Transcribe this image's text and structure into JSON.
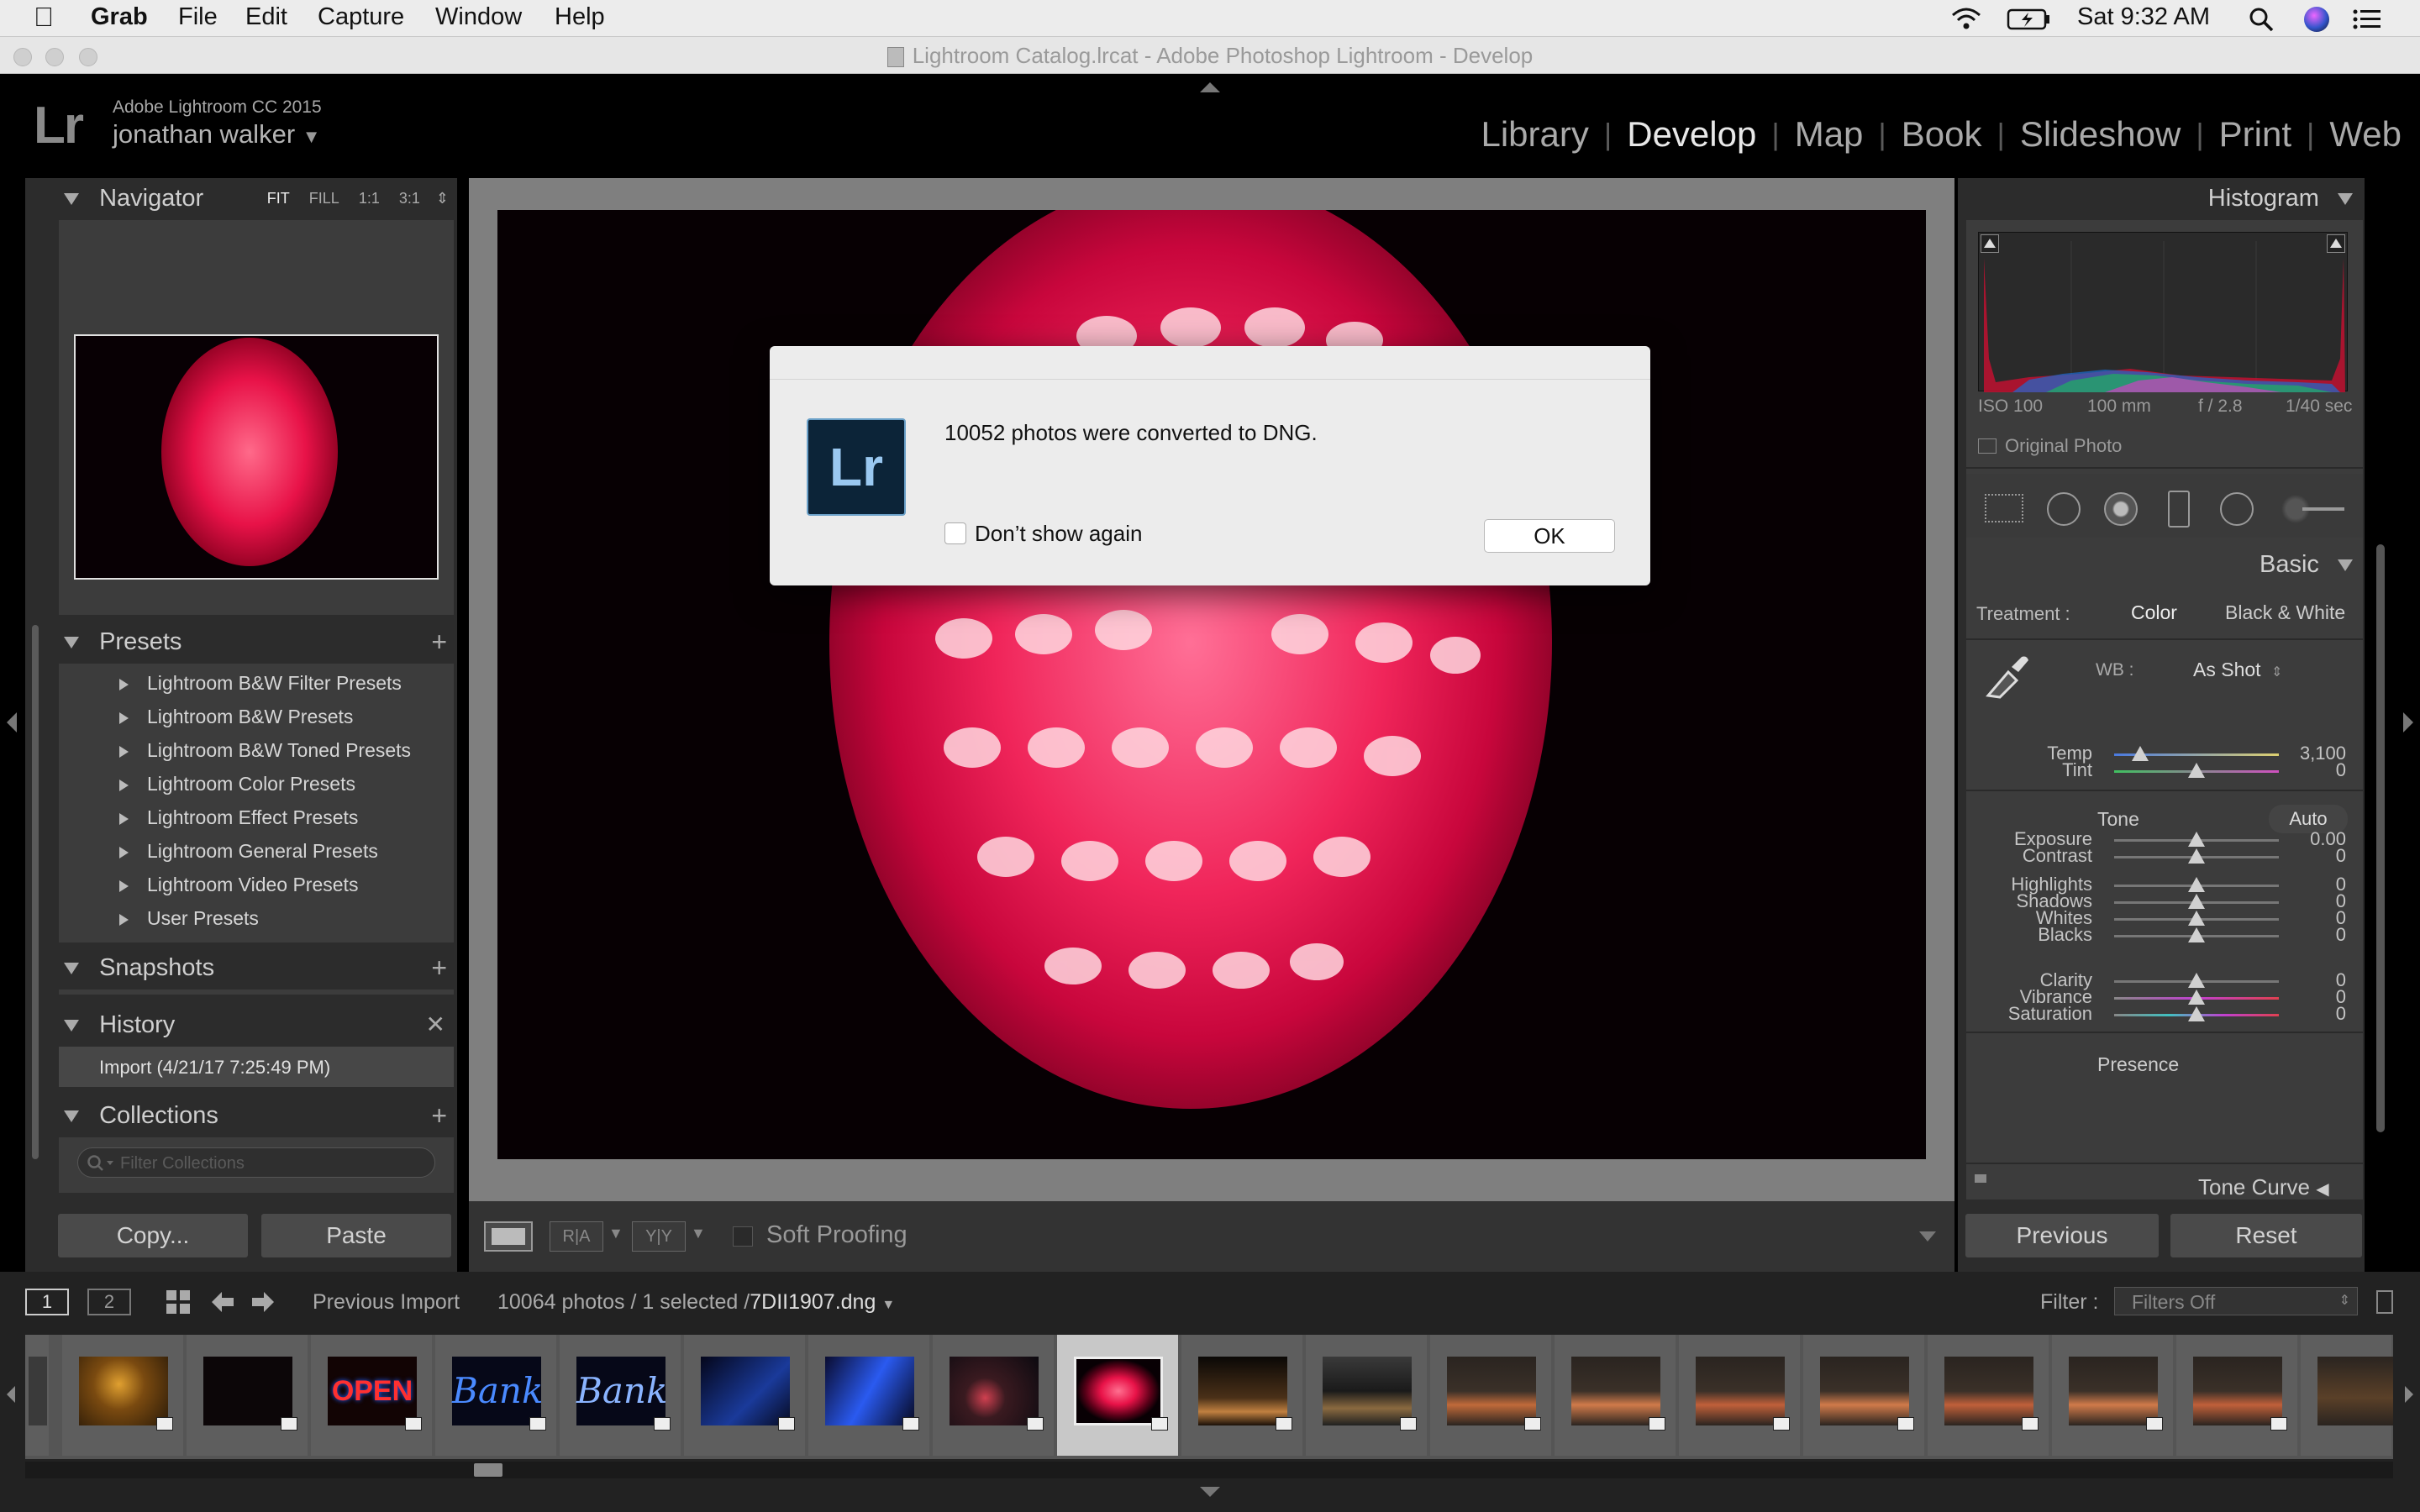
{
  "menubar": {
    "app": "Grab",
    "items": [
      "File",
      "Edit",
      "Capture",
      "Window",
      "Help"
    ],
    "clock": "Sat 9:32 AM"
  },
  "window": {
    "title": "Lightroom Catalog.lrcat - Adobe Photoshop Lightroom - Develop"
  },
  "identity": {
    "logo": "Lr",
    "product": "Adobe Lightroom CC 2015",
    "user": "jonathan walker"
  },
  "modules": [
    "Library",
    "Develop",
    "Map",
    "Book",
    "Slideshow",
    "Print",
    "Web"
  ],
  "active_module": "Develop",
  "navigator": {
    "title": "Navigator",
    "zoom": [
      "FIT",
      "FILL",
      "1:1",
      "3:1"
    ]
  },
  "presets": {
    "title": "Presets",
    "items": [
      "Lightroom B&W Filter Presets",
      "Lightroom B&W Presets",
      "Lightroom B&W Toned Presets",
      "Lightroom Color Presets",
      "Lightroom Effect Presets",
      "Lightroom General Presets",
      "Lightroom Video Presets",
      "User Presets"
    ]
  },
  "snapshots": {
    "title": "Snapshots"
  },
  "history": {
    "title": "History",
    "items": [
      "Import (4/21/17 7:25:49 PM)"
    ]
  },
  "collections": {
    "title": "Collections",
    "filter_placeholder": "Filter Collections"
  },
  "left_buttons": {
    "copy": "Copy...",
    "paste": "Paste"
  },
  "toolbar": {
    "soft_proofing": "Soft Proofing"
  },
  "histogram": {
    "title": "Histogram",
    "iso": "ISO 100",
    "focal": "100 mm",
    "aperture": "f / 2.8",
    "shutter": "1/40 sec",
    "original_photo": "Original Photo"
  },
  "basic": {
    "title": "Basic",
    "treatment_label": "Treatment :",
    "treatment_color": "Color",
    "treatment_bw": "Black & White",
    "wb_label": "WB :",
    "wb_value": "As Shot",
    "tone_label": "Tone",
    "auto": "Auto",
    "presence_label": "Presence",
    "sliders": [
      {
        "name": "Temp",
        "value": "3,100",
        "pos": 0.16
      },
      {
        "name": "Tint",
        "value": "0",
        "pos": 0.5
      },
      {
        "name": "Exposure",
        "value": "0.00",
        "pos": 0.5
      },
      {
        "name": "Contrast",
        "value": "0",
        "pos": 0.5
      },
      {
        "name": "Highlights",
        "value": "0",
        "pos": 0.5
      },
      {
        "name": "Shadows",
        "value": "0",
        "pos": 0.5
      },
      {
        "name": "Whites",
        "value": "0",
        "pos": 0.5
      },
      {
        "name": "Blacks",
        "value": "0",
        "pos": 0.5
      },
      {
        "name": "Clarity",
        "value": "0",
        "pos": 0.5
      },
      {
        "name": "Vibrance",
        "value": "0",
        "pos": 0.5
      },
      {
        "name": "Saturation",
        "value": "0",
        "pos": 0.5
      }
    ],
    "tone_curve": "Tone Curve"
  },
  "right_buttons": {
    "previous": "Previous",
    "reset": "Reset"
  },
  "filmstrip": {
    "screen1": "1",
    "screen2": "2",
    "source": "Previous Import",
    "count": "10064 photos / 1 selected /",
    "filename": "7DII1907.dng",
    "filter_label": "Filter :",
    "filter_value": "Filters Off"
  },
  "dialog": {
    "logo": "Lr",
    "message": "10052 photos were converted to DNG.",
    "checkbox": "Don’t show again",
    "ok": "OK"
  }
}
